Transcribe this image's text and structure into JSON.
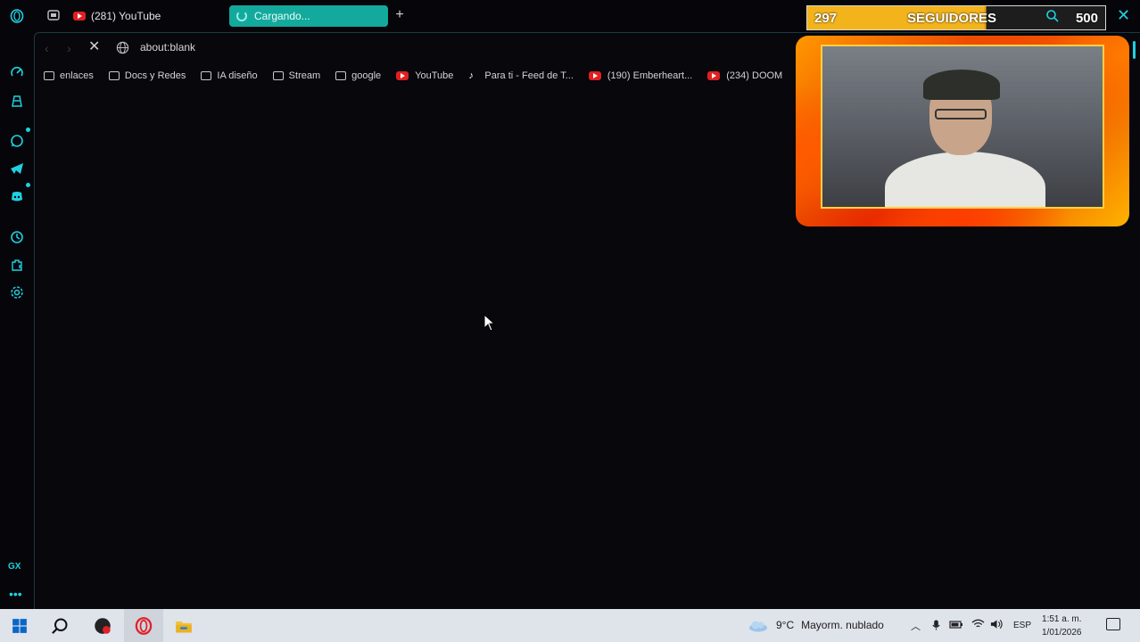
{
  "browser": {
    "tabs": [
      {
        "label": "(281) YouTube",
        "icon": "youtube-icon"
      },
      {
        "label": "Cargando...",
        "icon": "loading-spinner-icon",
        "active": true
      }
    ],
    "address": "about:blank",
    "bookmarks": [
      {
        "label": "enlaces",
        "icon": "folder-icon"
      },
      {
        "label": "Docs y Redes",
        "icon": "folder-icon"
      },
      {
        "label": "IA diseño",
        "icon": "folder-icon"
      },
      {
        "label": "Stream",
        "icon": "folder-icon"
      },
      {
        "label": "google",
        "icon": "folder-icon"
      },
      {
        "label": "YouTube",
        "icon": "youtube-icon"
      },
      {
        "label": "Para ti - Feed de T...",
        "icon": "tiktok-icon"
      },
      {
        "label": "(190) Emberheart...",
        "icon": "youtube-icon"
      },
      {
        "label": "(234) DOOM",
        "icon": "youtube-icon"
      }
    ],
    "sidebar_gx": "GX",
    "accent": "#1fd1e0"
  },
  "overlay": {
    "followers_current": "297",
    "followers_label": "SEGUIDORES",
    "followers_goal": "500",
    "progress": 0.594
  },
  "taskbar": {
    "weather_temp": "9°C",
    "weather_text": "Mayorm. nublado",
    "language": "ESP",
    "time": "1:51 a. m.",
    "date": "1/01/2026"
  }
}
